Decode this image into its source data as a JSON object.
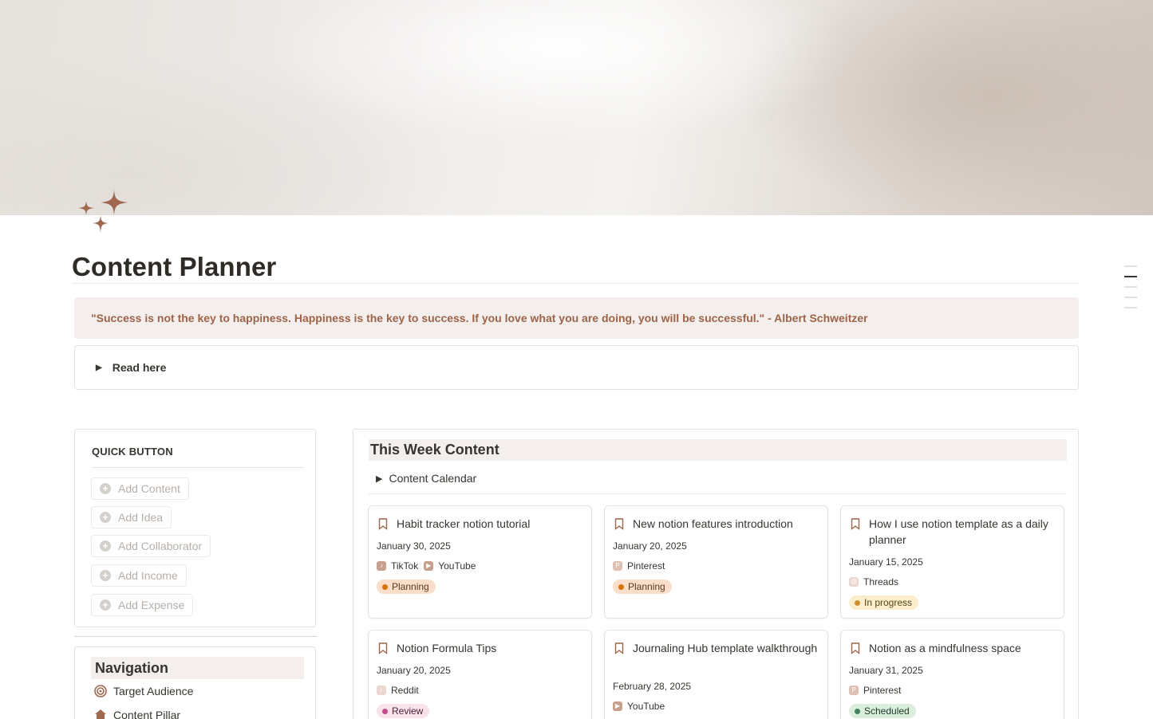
{
  "page": {
    "title": "Content Planner",
    "quote": "\"Success is not the key to happiness. Happiness is the key to success. If you love what you are doing, you will be successful.\" - Albert Schweitzer",
    "toggle_label": "Read here"
  },
  "colors": {
    "accent": "#9c6448",
    "highlight_bg": "#f4eeec",
    "planning_bg": "#fadec9",
    "planning_dot": "#d9730d",
    "progress_bg": "#fbeecc",
    "progress_dot": "#cb912f",
    "review_bg": "#f9e2ea",
    "review_dot": "#c14c8a",
    "scheduled_bg": "#dbeddb",
    "scheduled_dot": "#448361"
  },
  "quick": {
    "title": "QUICK BUTTON",
    "buttons": [
      "Add Content",
      "Add Idea",
      "Add Collaborator",
      "Add Income",
      "Add Expense"
    ]
  },
  "navigation": {
    "title": "Navigation",
    "items": [
      {
        "label": "Target Audience",
        "icon": "target-icon"
      },
      {
        "label": "Content Pillar",
        "icon": "home-icon"
      }
    ]
  },
  "week": {
    "title": "This Week Content",
    "calendar_label": "Content Calendar",
    "cards": [
      {
        "title": "Habit tracker notion tutorial",
        "date": "January 30, 2025",
        "platforms": [
          "TikTok",
          "YouTube"
        ],
        "status": "Planning"
      },
      {
        "title": "New notion features introduction",
        "date": "January 20, 2025",
        "platforms": [
          "Pinterest"
        ],
        "status": "Planning"
      },
      {
        "title": "How I use notion template as a daily planner",
        "date": "January 15, 2025",
        "platforms": [
          "Threads"
        ],
        "status": "In progress"
      },
      {
        "title": "Notion Formula Tips",
        "date": "January 20, 2025",
        "platforms": [
          "Reddit"
        ],
        "status": "Review"
      },
      {
        "title": "Journaling Hub template walkthrough",
        "date": "February 28, 2025",
        "platforms": [
          "YouTube"
        ],
        "status": ""
      },
      {
        "title": "Notion as a mindfulness space",
        "date": "January 31, 2025",
        "platforms": [
          "Pinterest"
        ],
        "status": "Scheduled"
      }
    ]
  }
}
